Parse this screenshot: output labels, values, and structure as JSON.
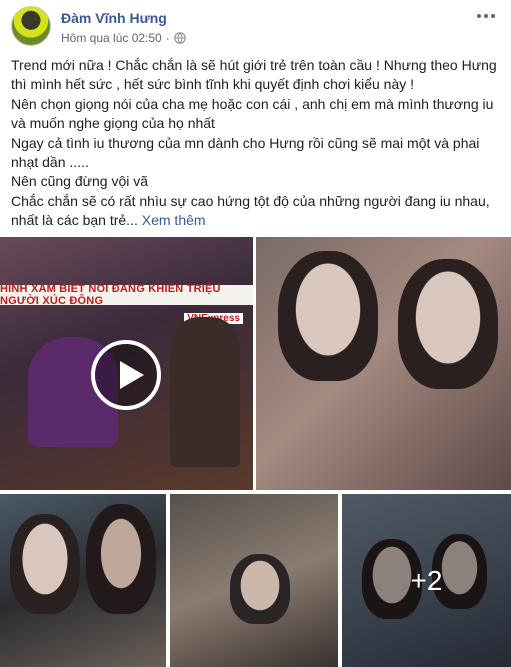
{
  "post": {
    "author": "Đàm Vĩnh Hưng",
    "timestamp": "Hôm qua lúc 02:50",
    "privacy_icon": "globe-icon",
    "text_lines": [
      "Trend mới nữa ! Chắc chắn là sẽ hút giới trẻ trên toàn cầu ! Nhưng theo Hưng",
      "thì mình hết sức , hết sức bình tĩnh khi quyết định chơi kiểu này !",
      "Nên chọn giọng nói của cha mẹ hoặc con cái , anh chị em mà mình thương iu",
      "và muốn nghe giọng của họ nhất",
      "Ngay cả tình iu thương của mn dành cho Hưng rồi cũng sẽ mai một và phai",
      "nhạt dần .....",
      "Nên cũng đừng vội vã",
      "Chắc chắn sẽ có rất nhìu sự cao hứng tột độ của những người đang iu nhau,",
      "nhất là các bạn trẻ..."
    ],
    "see_more": "Xem thêm"
  },
  "media": {
    "video_banner": "HÌNH XĂM BIẾT NÓI ĐANG KHIẾN TRIỆU NGƯỜI XÚC ĐỘNG",
    "video_logo": "VNExpress",
    "more_count": "+2"
  },
  "colors": {
    "link": "#385898",
    "text": "#1c1e21",
    "meta": "#616770",
    "banner_text": "#c21a1a"
  }
}
